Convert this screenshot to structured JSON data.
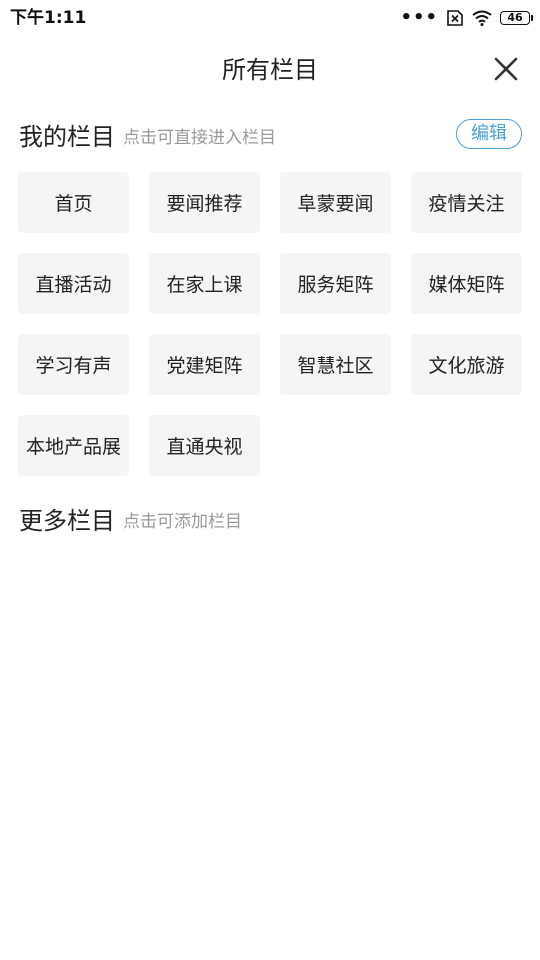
{
  "status_bar": {
    "time": "下午1:11",
    "battery": "46"
  },
  "header": {
    "title": "所有栏目"
  },
  "my_channels": {
    "title": "我的栏目",
    "hint": "点击可直接进入栏目",
    "edit_label": "编辑",
    "items": [
      "首页",
      "要闻推荐",
      "阜蒙要闻",
      "疫情关注",
      "直播活动",
      "在家上课",
      "服务矩阵",
      "媒体矩阵",
      "学习有声",
      "党建矩阵",
      "智慧社区",
      "文化旅游",
      "本地产品展",
      "直通央视"
    ]
  },
  "more_channels": {
    "title": "更多栏目",
    "hint": "点击可添加栏目"
  },
  "colors": {
    "accent": "#4a9fd8",
    "tile_bg": "#f5f5f5",
    "hint_text": "#9a9a9a"
  }
}
